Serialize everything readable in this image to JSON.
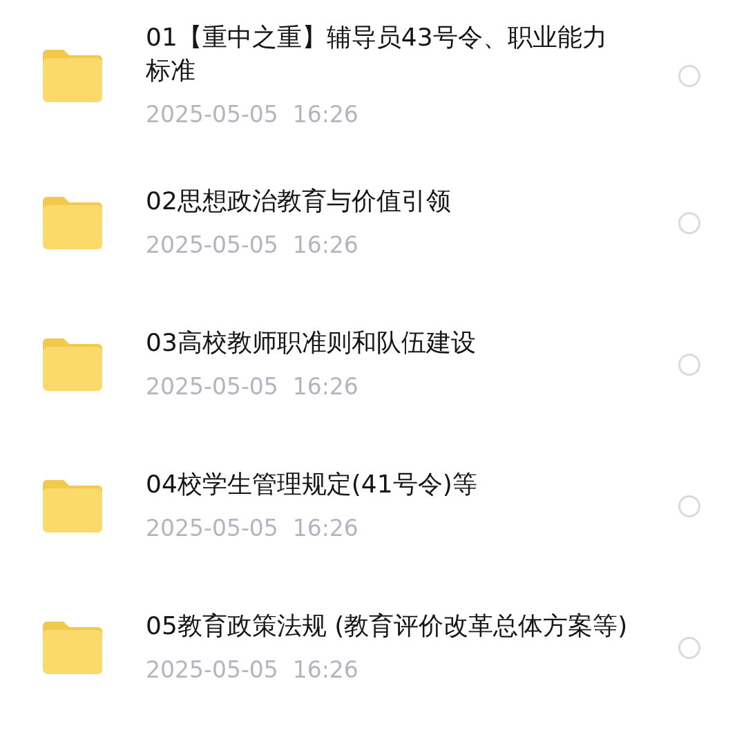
{
  "files": [
    {
      "name": "01【重中之重】辅导员43号令、职业能力标准",
      "date": "2025-05-05  16:26",
      "selected": false
    },
    {
      "name": "02思想政治教育与价值引领",
      "date": "2025-05-05  16:26",
      "selected": false
    },
    {
      "name": "03高校教师职准则和队伍建设",
      "date": "2025-05-05  16:26",
      "selected": false
    },
    {
      "name": "04校学生管理规定(41号令)等",
      "date": "2025-05-05  16:26",
      "selected": false
    },
    {
      "name": "05教育政策法规 (教育评价改革总体方案等)",
      "date": "2025-05-05  16:26",
      "selected": false
    }
  ]
}
